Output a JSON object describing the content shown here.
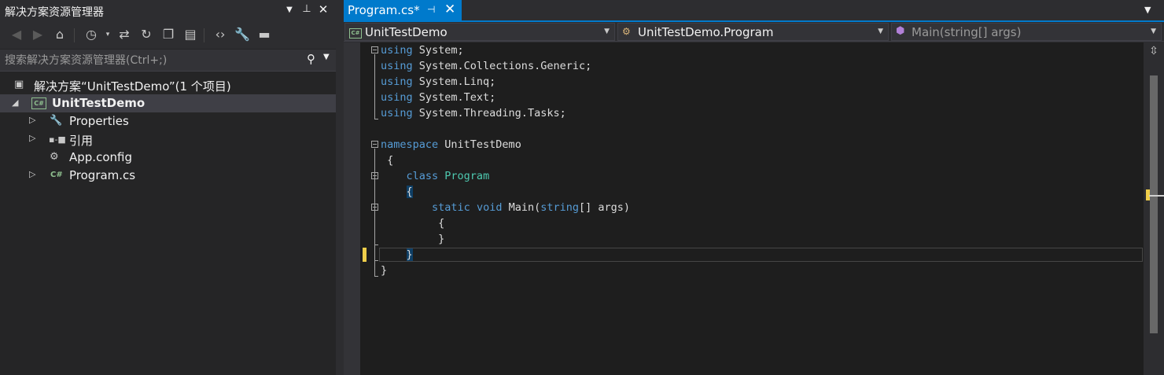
{
  "solution_explorer": {
    "title": "解决方案资源管理器",
    "title_icons": [
      "dropdown-icon",
      "pin-icon",
      "close-icon"
    ],
    "toolbar_icons": [
      "back-icon",
      "forward-icon",
      "home-icon",
      "history-icon",
      "sync-icon",
      "refresh-icon",
      "collapse-all-icon",
      "show-all-files-icon",
      "view-code-icon",
      "properties-icon",
      "preview-icon"
    ],
    "search_placeholder": "搜索解决方案资源管理器(Ctrl+;)",
    "tree": {
      "solution": "解决方案“UnitTestDemo”(1 个项目)",
      "project": "UnitTestDemo",
      "items": [
        {
          "label": "Properties",
          "icon": "wrench-icon"
        },
        {
          "label": "引用",
          "icon": "references-icon"
        },
        {
          "label": "App.config",
          "icon": "config-icon"
        },
        {
          "label": "Program.cs",
          "icon": "csharp-file-icon"
        }
      ]
    },
    "cs_badge": "C#"
  },
  "editor": {
    "tab": {
      "label": "Program.cs*",
      "pin": "⊣",
      "close": "✕"
    },
    "nav": {
      "project": "UnitTestDemo",
      "type": "UnitTestDemo.Program",
      "member": "Main(string[] args)"
    },
    "code": {
      "l1_kw": "using",
      "l1_rest": " System;",
      "l2_kw": "using",
      "l2_rest": " System.Collections.Generic;",
      "l3_kw": "using",
      "l3_rest": " System.Linq;",
      "l4_kw": "using",
      "l4_rest": " System.Text;",
      "l5_kw": "using",
      "l5_rest": " System.Threading.Tasks;",
      "l7_kw": "namespace",
      "l7_rest": " UnitTestDemo",
      "l8": " {",
      "l9_indent": "    ",
      "l9_kw": "class",
      "l9_sp": " ",
      "l9_type": "Program",
      "l10_indent": "    ",
      "l10_brace": "{",
      "l11_indent": "        ",
      "l11_kw1": "static",
      "l11_sp1": " ",
      "l11_kw2": "void",
      "l11_mid": " Main(",
      "l11_kw3": "string",
      "l11_end": "[] args)",
      "l12": "         {",
      "l13": "         }",
      "l14_indent": "    ",
      "l14_brace": "}",
      "l15": "}"
    }
  }
}
